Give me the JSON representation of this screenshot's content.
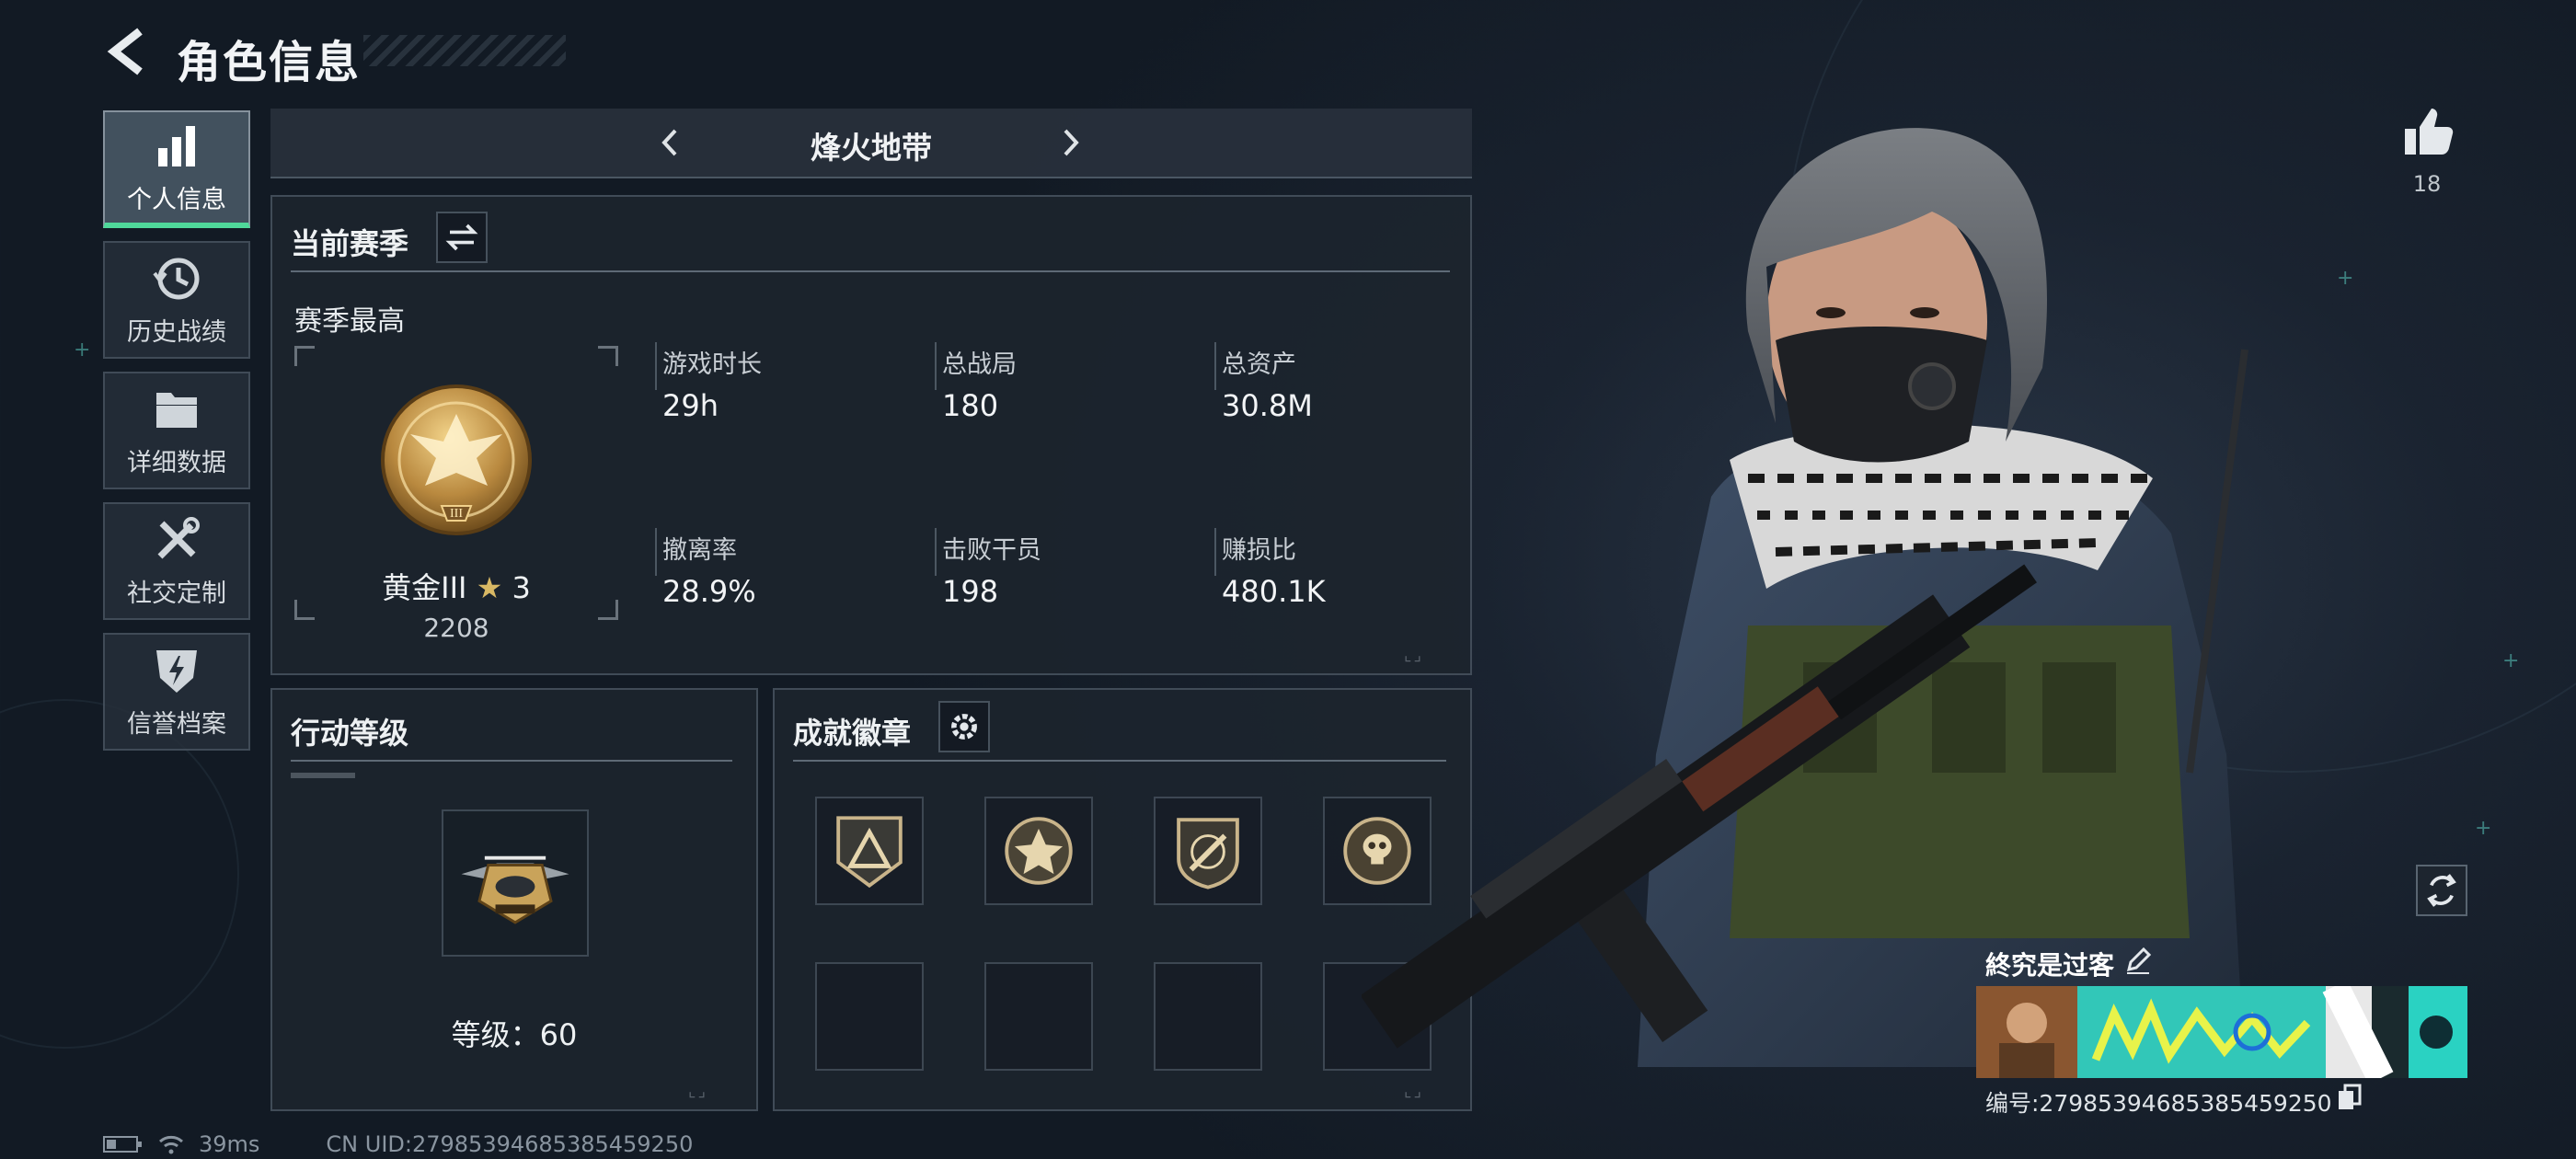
{
  "header": {
    "title": "角色信息"
  },
  "sidebar": {
    "items": [
      {
        "label": "个人信息",
        "icon": "bar-chart-icon",
        "active": true
      },
      {
        "label": "历史战绩",
        "icon": "history-clock-icon",
        "active": false
      },
      {
        "label": "详细数据",
        "icon": "folder-icon",
        "active": false
      },
      {
        "label": "社交定制",
        "icon": "tools-icon",
        "active": false
      },
      {
        "label": "信誉档案",
        "icon": "shield-bolt-icon",
        "active": false
      }
    ]
  },
  "mode": {
    "name": "烽火地带"
  },
  "season": {
    "section_title": "当前赛季",
    "best_label": "赛季最高",
    "rank_name": "黄金III",
    "rank_stars": "3",
    "rank_score": "2208",
    "stats": [
      {
        "label": "游戏时长",
        "value": "29h"
      },
      {
        "label": "总战局",
        "value": "180"
      },
      {
        "label": "总资产",
        "value": "30.8M"
      },
      {
        "label": "撤离率",
        "value": "28.9%"
      },
      {
        "label": "击败干员",
        "value": "198"
      },
      {
        "label": "赚损比",
        "value": "480.1K"
      }
    ]
  },
  "action_level": {
    "section_title": "行动等级",
    "level_label": "等级：",
    "level_value": "60"
  },
  "achievements": {
    "section_title": "成就徽章",
    "badges": [
      "triangle-shield-badge",
      "star-medal-badge",
      "knife-shield-badge",
      "skull-wreath-badge"
    ],
    "empty_slots": 4
  },
  "footer": {
    "ping": "39ms",
    "uid": "CN UID:279853946853854592​50"
  },
  "profile": {
    "likes": "18",
    "player_name": "終究是过客",
    "banner_id": "编号:27985394685385459250"
  },
  "colors": {
    "accent_green": "#4fd89a",
    "gold": "#c9a35a"
  }
}
